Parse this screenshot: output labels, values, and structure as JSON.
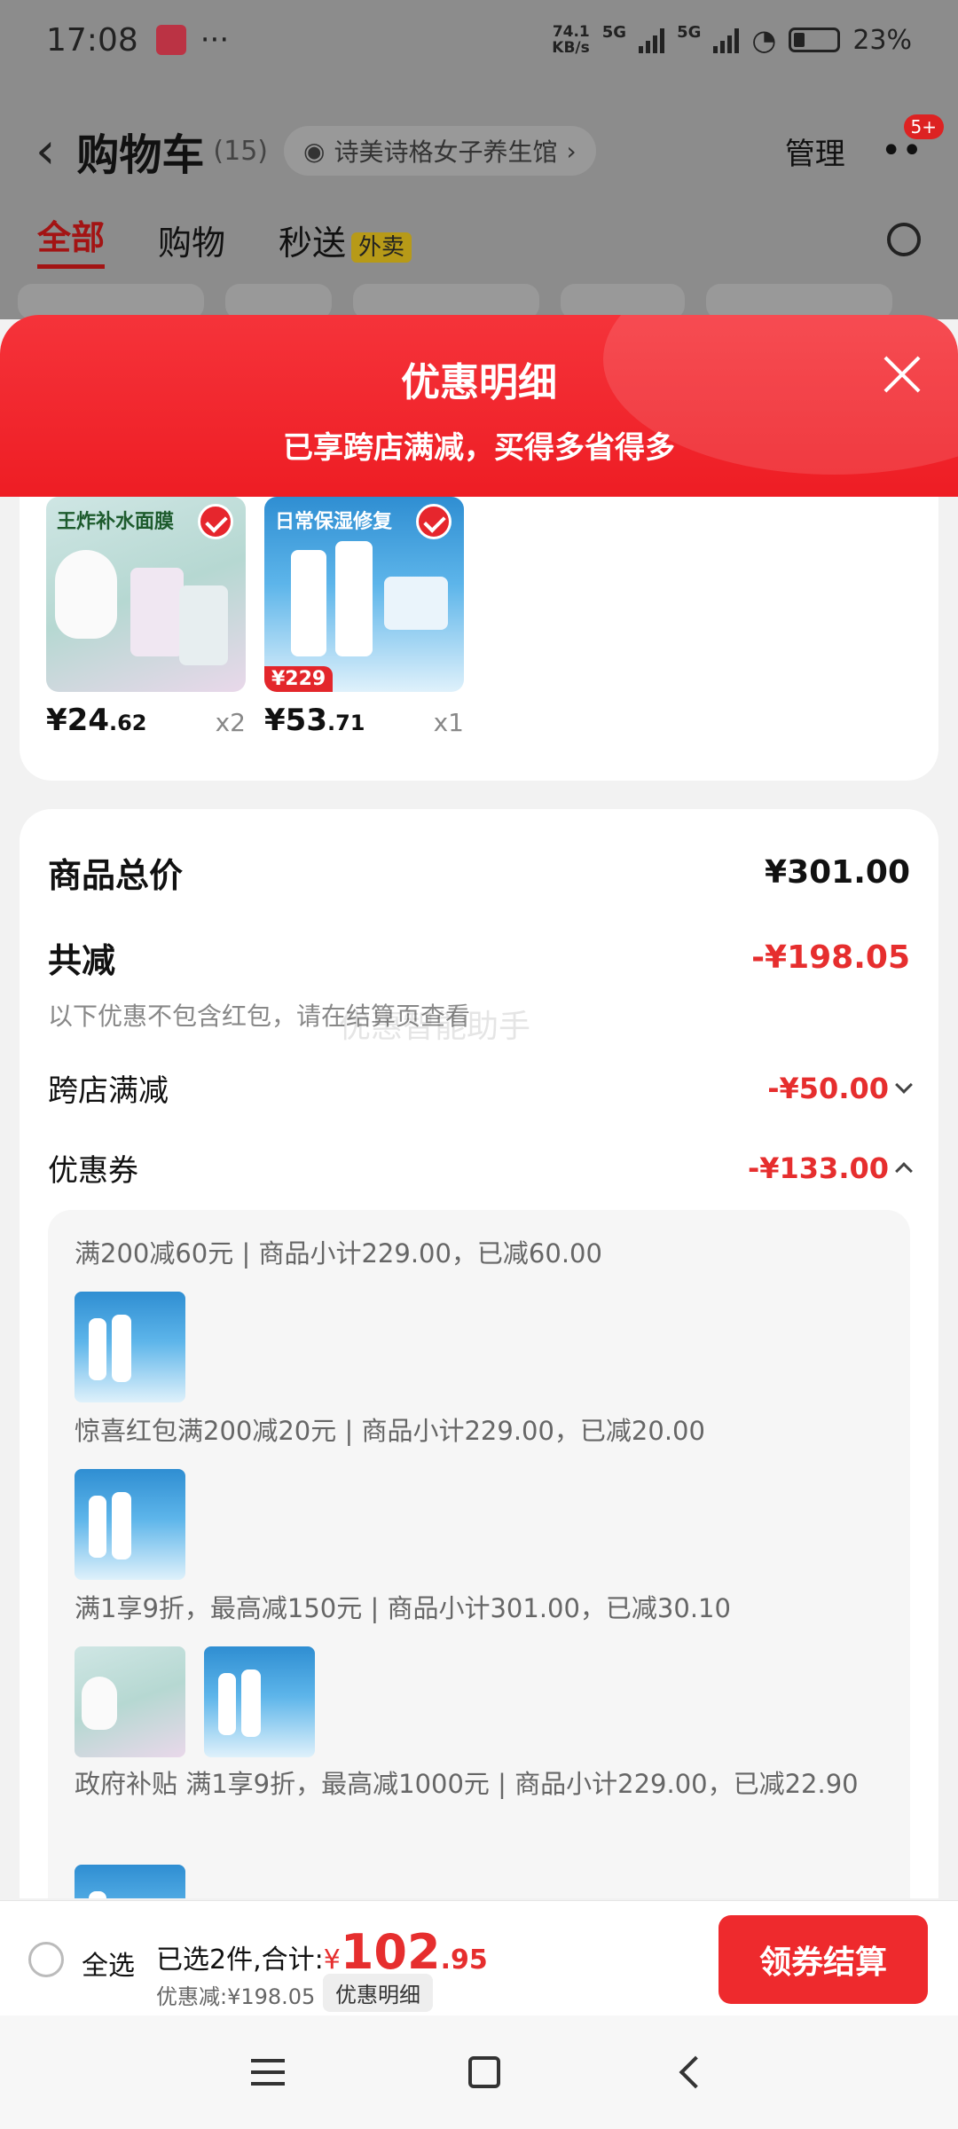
{
  "status_bar": {
    "time": "17:08",
    "net_speed_top": "74.1",
    "net_speed_bottom": "KB/s",
    "signal_1": "5G",
    "signal_2": "5G",
    "battery": "23%"
  },
  "header": {
    "title": "购物车",
    "count": "(15)",
    "shop_name": "诗美诗格女子养生馆",
    "manage": "管理",
    "badge": "5+"
  },
  "tabs": [
    {
      "label": "全部"
    },
    {
      "label": "购物"
    },
    {
      "label": "秒送"
    }
  ],
  "tab_tag": "外卖",
  "sheet": {
    "title": "优惠明细",
    "subtitle": "已享跨店满减，买得多省得多"
  },
  "products": [
    {
      "image_caption": "王炸补水面膜",
      "price_int": "¥24",
      "price_dec": ".62",
      "qty": "x2"
    },
    {
      "image_caption": "日常保湿修复",
      "price_tag": "¥229",
      "price_int": "¥53",
      "price_dec": ".71",
      "qty": "x1"
    }
  ],
  "summary": {
    "total_label": "商品总价",
    "total_value": "¥301.00",
    "reduce_label": "共减",
    "reduce_value": "-¥198.05",
    "note": "以下优惠不包含红包，请在结算页查看",
    "watermark": "优惠智能助手",
    "cross_store_label": "跨店满减",
    "cross_store_value": "-¥50.00",
    "coupon_label": "优惠券",
    "coupon_value": "-¥133.00"
  },
  "coupons": [
    "满200减60元 | 商品小计229.00，已减60.00",
    "惊喜红包满200减20元 | 商品小计229.00，已减20.00",
    "满1享9折，最高减150元 | 商品小计301.00，已减30.10",
    "政府补贴 满1享9折，最高减1000元 | 商品小计229.00，已减22.90"
  ],
  "bottom": {
    "select_all": "全选",
    "selected_text": "已选2件,合计:",
    "currency": "¥",
    "amount_int": "102",
    "amount_dec": ".95",
    "saved_text": "优惠减:¥198.05",
    "detail_button": "优惠明细",
    "checkout_button": "领券结算"
  },
  "colors": {
    "accent_red": "#ee2a2d",
    "discount_red": "#e62e2e"
  }
}
